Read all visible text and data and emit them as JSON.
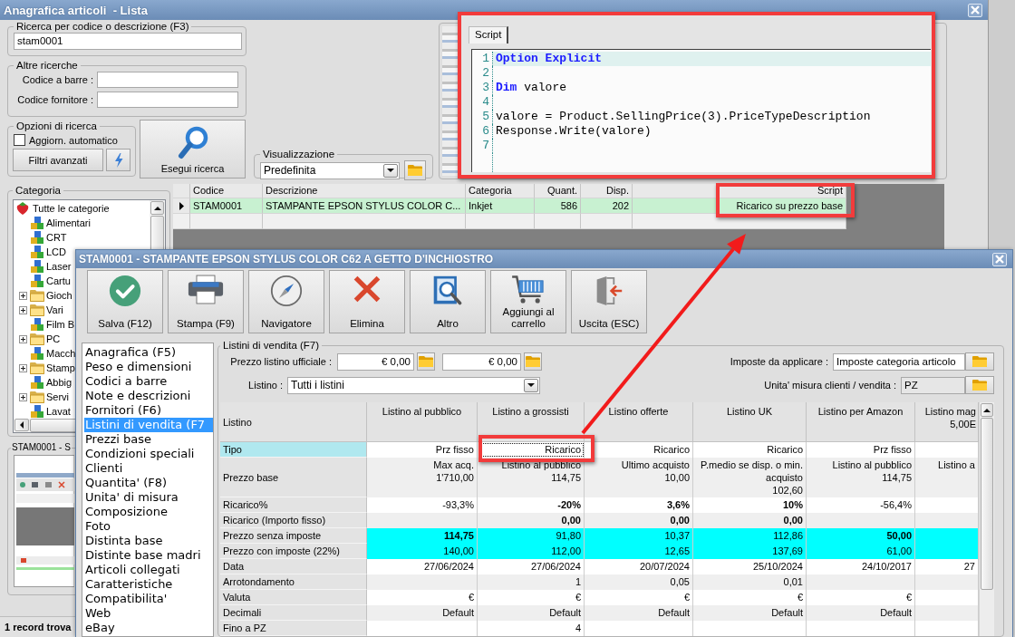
{
  "main_window": {
    "title": "Anagrafica articoli  - Lista",
    "search": {
      "label": "Ricerca per codice o descrizione (F3)",
      "value": "stam0001"
    },
    "other_searches": {
      "label": "Altre ricerche",
      "fields": [
        {
          "label": "Codice a barre :"
        },
        {
          "label": "Codice fornitore :"
        }
      ]
    },
    "search_options": {
      "label": "Opzioni di ricerca",
      "auto_update": {
        "label": "Aggiorn. automatico",
        "checked": false
      },
      "filters_button": "Filtri avanzati"
    },
    "run_search_button": "Esegui ricerca",
    "view": {
      "label": "Visualizzazione",
      "value": "Predefinita"
    },
    "category": {
      "label": "Categoria",
      "tree": [
        {
          "label": "Tutte le categorie",
          "kind": "root",
          "children": [
            {
              "label": "Alimentari",
              "kind": "category"
            },
            {
              "label": "CRT",
              "kind": "category"
            },
            {
              "label": "LCD",
              "kind": "category"
            },
            {
              "label": "Laser",
              "kind": "category"
            },
            {
              "label": "Cartu",
              "kind": "category"
            },
            {
              "label": "Gioch",
              "kind": "folder",
              "expanded": false
            },
            {
              "label": "Vari",
              "kind": "folder",
              "expanded": false
            },
            {
              "label": "Film B",
              "kind": "category"
            },
            {
              "label": "PC",
              "kind": "folder",
              "expanded": false
            },
            {
              "label": "Macch",
              "kind": "category"
            },
            {
              "label": "Stamp",
              "kind": "folder",
              "expanded": false
            },
            {
              "label": "Abbig",
              "kind": "category"
            },
            {
              "label": "Servi",
              "kind": "folder",
              "expanded": false
            },
            {
              "label": "Lavat",
              "kind": "category"
            }
          ]
        }
      ]
    },
    "preview": {
      "label": "STAM0001 - S"
    },
    "results": {
      "columns": [
        "Codice",
        "Descrizione",
        "Categoria",
        "Quant.",
        "Disp.",
        "Script"
      ],
      "rows": [
        {
          "selected": true,
          "cells": [
            "STAM0001",
            "STAMPANTE EPSON STYLUS COLOR C...",
            "Inkjet",
            "586",
            "202",
            "Ricarico su prezzo base"
          ]
        }
      ]
    },
    "status_bar": "1 record trova"
  },
  "script_window": {
    "tab": "Script",
    "lines": [
      {
        "number": "1",
        "current": true,
        "tokens": [
          {
            "text": "Option Explicit",
            "kind": "keyword"
          }
        ]
      },
      {
        "number": "2",
        "current": false
      },
      {
        "number": "3",
        "current": false,
        "tokens": [
          {
            "text": "Dim",
            "kind": "keyword"
          },
          {
            "text": " valore",
            "kind": "plain"
          }
        ]
      },
      {
        "number": "4",
        "current": false
      },
      {
        "number": "5",
        "current": false,
        "tokens": [
          {
            "text": "valore = Product.SellingPrice(3).PriceTypeDescription",
            "kind": "plain"
          }
        ]
      },
      {
        "number": "6",
        "current": false,
        "tokens": [
          {
            "text": "Response.Write(valore)",
            "kind": "plain"
          }
        ]
      },
      {
        "number": "7",
        "current": false
      }
    ]
  },
  "item_dialog": {
    "title": "STAM0001 - STAMPANTE EPSON STYLUS COLOR C62 A GETTO D'INCHIOSTRO",
    "toolbar": [
      {
        "label": "Salva (F12)",
        "kind": "save"
      },
      {
        "label": "Stampa (F9)",
        "kind": "print"
      },
      {
        "label": "Navigatore",
        "kind": "navigator"
      },
      {
        "label": "Elimina",
        "kind": "delete"
      },
      {
        "label": "Altro",
        "kind": "more"
      },
      {
        "label": "Aggiungi al carrello",
        "kind": "cart"
      },
      {
        "label": "Uscita (ESC)",
        "kind": "exit"
      }
    ],
    "sections": [
      {
        "label": "Anagrafica (F5)",
        "selected": false
      },
      {
        "label": "Peso e dimensioni",
        "selected": false
      },
      {
        "label": "Codici a barre",
        "selected": false
      },
      {
        "label": "Note e descrizioni",
        "selected": false
      },
      {
        "label": "Fornitori (F6)",
        "selected": false
      },
      {
        "label": "Listini di vendita (F7",
        "selected": true
      },
      {
        "label": "Prezzi base",
        "selected": false
      },
      {
        "label": "Condizioni speciali",
        "selected": false
      },
      {
        "label": "Clienti",
        "selected": false
      },
      {
        "label": "Quantita' (F8)",
        "selected": false
      },
      {
        "label": "Unita' di misura",
        "selected": false
      },
      {
        "label": "Composizione",
        "selected": false
      },
      {
        "label": "Foto",
        "selected": false
      },
      {
        "label": "Distinta base",
        "selected": false
      },
      {
        "label": "Distinte base madri",
        "selected": false
      },
      {
        "label": "Articoli collegati",
        "selected": false
      },
      {
        "label": "Caratteristiche",
        "selected": false
      },
      {
        "label": "Compatibilita'",
        "selected": false
      },
      {
        "label": "Web",
        "selected": false
      },
      {
        "label": "eBay",
        "selected": false
      }
    ],
    "prices": {
      "label": "Listini di vendita (F7)",
      "official_price": {
        "label": "Prezzo listino ufficiale :",
        "values": [
          "€ 0,00",
          "€ 0,00"
        ]
      },
      "price_list": {
        "label": "Listino :",
        "value": "Tutti i listini"
      },
      "taxes": {
        "label": "Imposte da applicare :",
        "value": "Imposte categoria articolo"
      },
      "unit": {
        "label": "Unita' misura clienti / vendita :",
        "value": "PZ",
        "disabled": true
      },
      "table": {
        "corner": "Listino",
        "columns": [
          "Listino al pubblico",
          "Listino a grossisti",
          "Listino offerte",
          "Listino UK",
          "Listino per Amazon",
          "Listino mag\n5,00E"
        ],
        "rows": [
          {
            "label": "Tipo",
            "selected": true,
            "highlighted": false,
            "cells": [
              {
                "text": "Prz fisso",
                "bold": false,
                "focused": false
              },
              {
                "text": "Ricarico",
                "bold": false,
                "focused": true
              },
              {
                "text": "Ricarico",
                "bold": false,
                "focused": false
              },
              {
                "text": "Ricarico",
                "bold": false,
                "focused": false
              },
              {
                "text": "Prz fisso",
                "bold": false,
                "focused": false
              },
              null
            ]
          },
          {
            "label": "Prezzo base",
            "selected": false,
            "highlighted": false,
            "cells": [
              {
                "text": "Max acq.\n1'710,00",
                "bold": false
              },
              {
                "text": "Listino al pubblico\n114,75",
                "bold": false
              },
              {
                "text": "Ultimo acquisto\n10,00",
                "bold": false
              },
              {
                "text": "P.medio se disp. o min.\nacquisto\n102,60",
                "bold": false
              },
              {
                "text": "Listino al pubblico\n114,75",
                "bold": false
              },
              {
                "text": "Listino a",
                "bold": false
              }
            ]
          },
          {
            "label": "Ricarico%",
            "selected": false,
            "highlighted": false,
            "cells": [
              {
                "text": "-93,3%",
                "bold": false
              },
              {
                "text": "-20%",
                "bold": true
              },
              {
                "text": "3,6%",
                "bold": true
              },
              {
                "text": "10%",
                "bold": true
              },
              {
                "text": "-56,4%",
                "bold": false
              },
              null
            ]
          },
          {
            "label": "Ricarico (Importo fisso)",
            "selected": false,
            "highlighted": false,
            "cells": [
              null,
              {
                "text": "0,00",
                "bold": true
              },
              {
                "text": "0,00",
                "bold": true
              },
              {
                "text": "0,00",
                "bold": true
              },
              null,
              null
            ]
          },
          {
            "label": "Prezzo senza imposte",
            "selected": false,
            "highlighted": true,
            "cells": [
              {
                "text": "114,75",
                "bold": true
              },
              {
                "text": "91,80",
                "bold": false
              },
              {
                "text": "10,37",
                "bold": false
              },
              {
                "text": "112,86",
                "bold": false
              },
              {
                "text": "50,00",
                "bold": true
              },
              null
            ]
          },
          {
            "label": "Prezzo con imposte (22%)",
            "selected": false,
            "highlighted": true,
            "cells": [
              {
                "text": "140,00",
                "bold": false
              },
              {
                "text": "112,00",
                "bold": false
              },
              {
                "text": "12,65",
                "bold": false
              },
              {
                "text": "137,69",
                "bold": false
              },
              {
                "text": "61,00",
                "bold": false
              },
              null
            ]
          },
          {
            "label": "Data",
            "selected": false,
            "highlighted": false,
            "cells": [
              {
                "text": "27/06/2024",
                "bold": false
              },
              {
                "text": "27/06/2024",
                "bold": false
              },
              {
                "text": "20/07/2024",
                "bold": false
              },
              {
                "text": "25/10/2024",
                "bold": false
              },
              {
                "text": "24/10/2017",
                "bold": false
              },
              {
                "text": "27",
                "bold": false
              }
            ]
          },
          {
            "label": "Arrotondamento",
            "selected": false,
            "highlighted": false,
            "cells": [
              null,
              {
                "text": "1",
                "bold": false
              },
              {
                "text": "0,05",
                "bold": false
              },
              {
                "text": "0,01",
                "bold": false
              },
              null,
              null
            ]
          },
          {
            "label": "Valuta",
            "selected": false,
            "highlighted": false,
            "cells": [
              {
                "text": "€",
                "bold": false
              },
              {
                "text": "€",
                "bold": false
              },
              {
                "text": "€",
                "bold": false
              },
              {
                "text": "€",
                "bold": false
              },
              {
                "text": "€",
                "bold": false
              },
              null
            ]
          },
          {
            "label": "Decimali",
            "selected": false,
            "highlighted": false,
            "cells": [
              {
                "text": "Default",
                "bold": false
              },
              {
                "text": "Default",
                "bold": false
              },
              {
                "text": "Default",
                "bold": false
              },
              {
                "text": "Default",
                "bold": false
              },
              {
                "text": "Default",
                "bold": false
              },
              null
            ]
          },
          {
            "label": "Fino a PZ",
            "selected": false,
            "highlighted": false,
            "cells": [
              null,
              {
                "text": "4",
                "bold": false
              },
              null,
              null,
              null,
              null
            ]
          }
        ]
      }
    }
  }
}
